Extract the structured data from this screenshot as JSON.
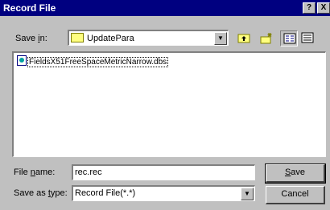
{
  "window": {
    "title": "Record File",
    "help_label": "?",
    "close_label": "X"
  },
  "save_in": {
    "label_pre": "Save ",
    "label_accel": "i",
    "label_post": "n:",
    "value": "UpdatePara",
    "icon": "folder-icon"
  },
  "toolbar": {
    "up_icon": "up-one-level-icon",
    "new_folder_icon": "new-folder-icon",
    "list_icon": "list-view-icon",
    "details_icon": "details-view-icon"
  },
  "files": [
    {
      "name": "FieldsX51FreeSpaceMetricNarrow.dbs",
      "icon": "dbs-file-icon"
    }
  ],
  "file_name": {
    "label_pre": "File ",
    "label_accel": "n",
    "label_post": "ame:",
    "value": "rec.rec"
  },
  "save_as_type": {
    "label_pre": "Save as ",
    "label_accel": "t",
    "label_post": "ype:",
    "value": "Record File(*.*)"
  },
  "buttons": {
    "save_accel": "S",
    "save_rest": "ave",
    "cancel": "Cancel"
  },
  "colors": {
    "titlebar": "#000080",
    "face": "#c0c0c0"
  }
}
